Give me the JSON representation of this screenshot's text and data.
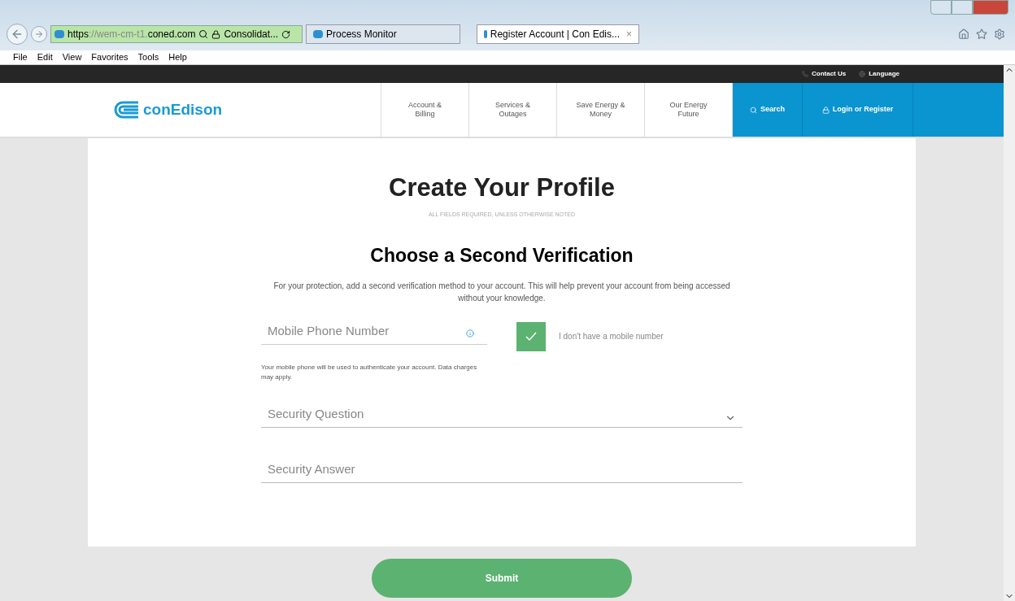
{
  "browser": {
    "address": {
      "scheme": "https",
      "host_prefix": "://wem-cm-t1.",
      "host": "coned.com",
      "site": "Consolidat..."
    },
    "tabs": [
      {
        "label": "Process Monitor",
        "selected": false
      },
      {
        "label": "Register Account | Con Edis...",
        "selected": true,
        "close": "×"
      }
    ],
    "menu": [
      "File",
      "Edit",
      "View",
      "Favorites",
      "Tools",
      "Help"
    ]
  },
  "utility": [
    "Contact Us",
    "Language"
  ],
  "header": {
    "logo": "conEdison",
    "nav": [
      "Account &\nBilling",
      "Services &\nOutages",
      "Save Energy &\nMoney",
      "Our Energy\nFuture"
    ],
    "search": "Search",
    "login": "Login or Register"
  },
  "form": {
    "title": "Create Your Profile",
    "note": "ALL FIELDS REQUIRED, UNLESS OTHERWISE NOTED",
    "subtitle": "Choose a Second Verification",
    "intro": "For your protection, add a second verification method to your account. This will help prevent your account from being accessed without your knowledge.",
    "phone": {
      "placeholder": "Mobile Phone Number",
      "help": "Your mobile phone will be used to authenticate your account. Data charges may apply."
    },
    "no_mobile": {
      "label": "I don't have a mobile number",
      "checked": true
    },
    "question": {
      "placeholder": "Security Question"
    },
    "answer": {
      "placeholder": "Security Answer"
    },
    "submit": "Submit"
  }
}
